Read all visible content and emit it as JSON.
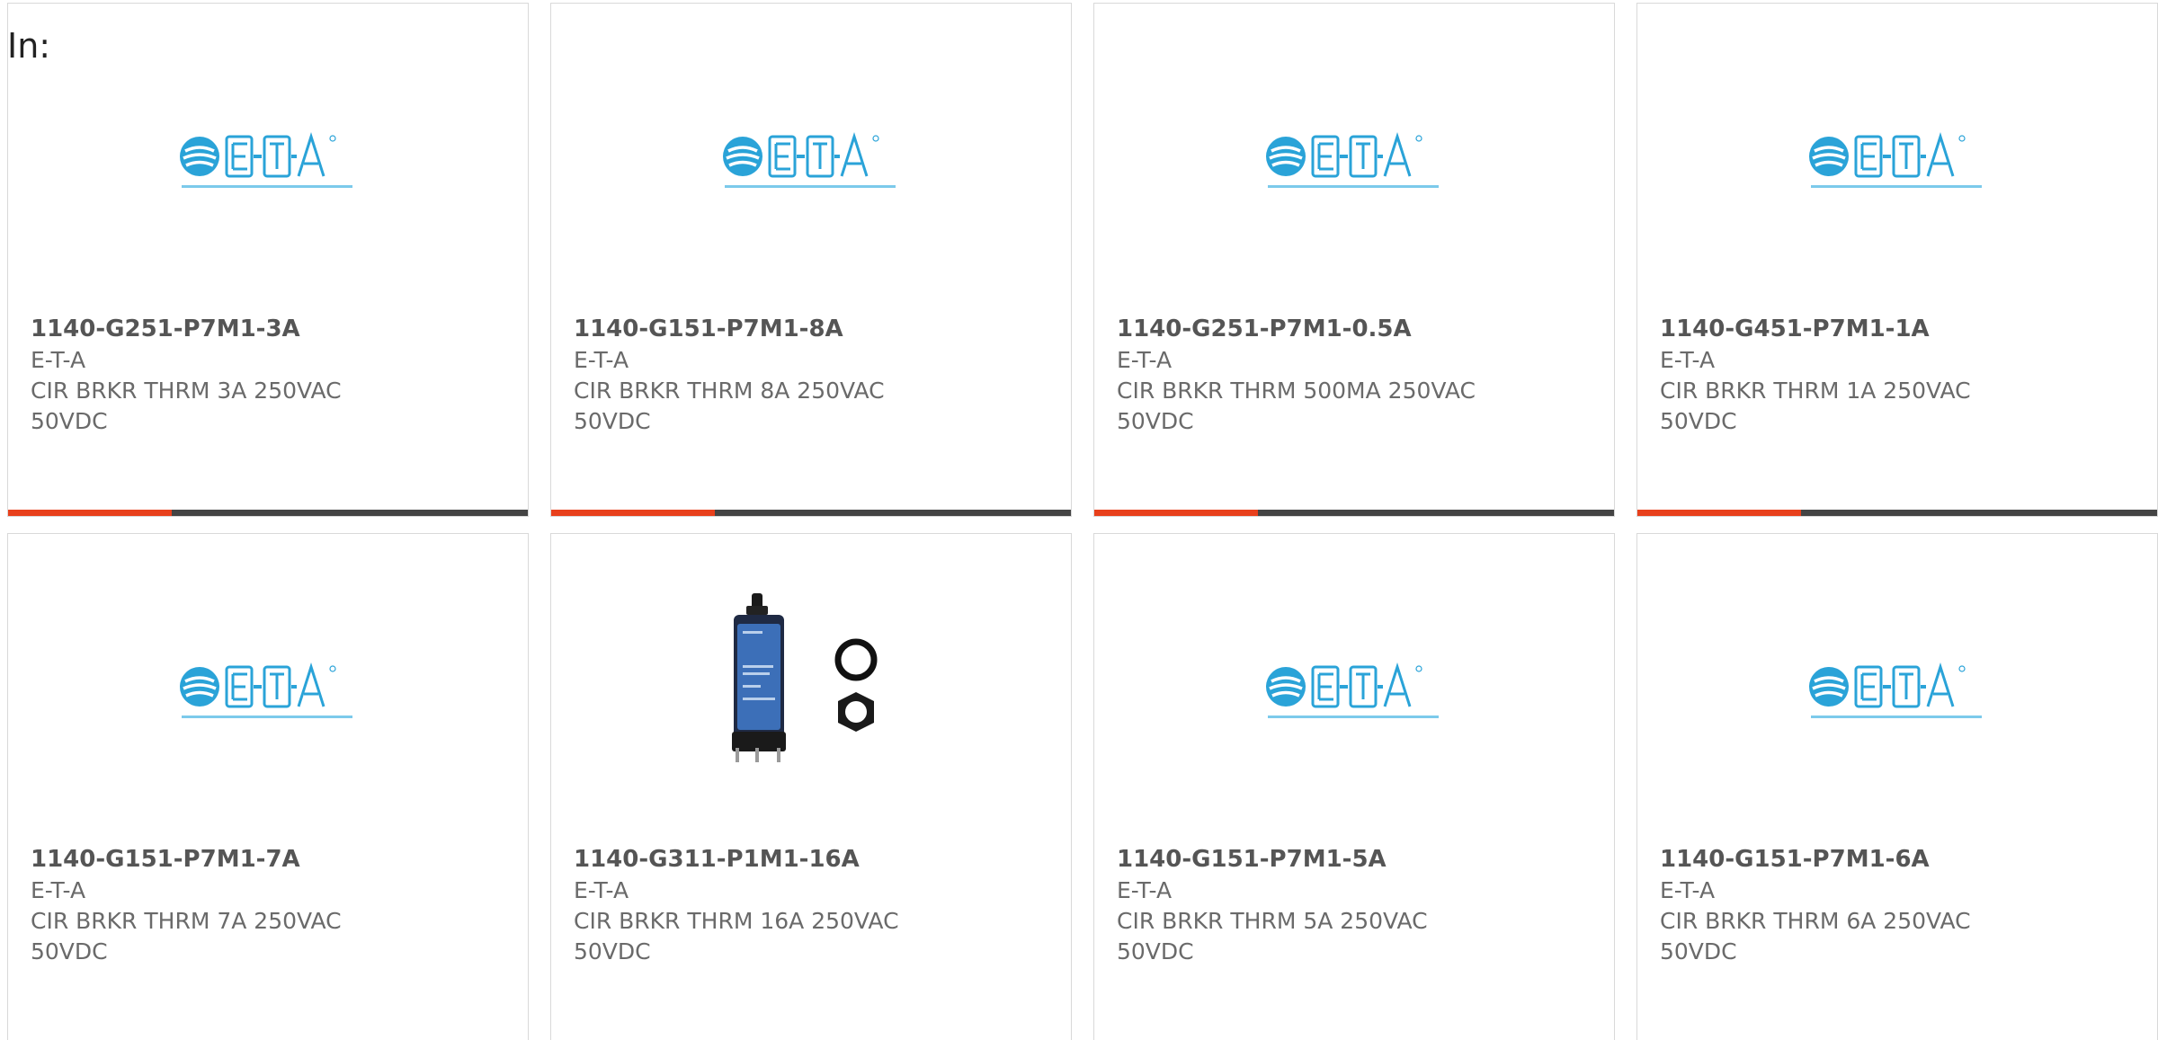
{
  "header": {
    "label": "In:"
  },
  "colors": {
    "accent": "#e8401c",
    "bar_dark": "#444444",
    "logo_blue": "#2aa3d8",
    "logo_light": "#7ccaeb"
  },
  "products": [
    {
      "part_number": "1140-G251-P7M1-3A",
      "manufacturer": "E-T-A",
      "description": "CIR BRKR THRM 3A 250VAC 50VDC",
      "image": "eta-logo-icon"
    },
    {
      "part_number": "1140-G151-P7M1-8A",
      "manufacturer": "E-T-A",
      "description": "CIR BRKR THRM 8A 250VAC 50VDC",
      "image": "eta-logo-icon"
    },
    {
      "part_number": "1140-G251-P7M1-0.5A",
      "manufacturer": "E-T-A",
      "description": "CIR BRKR THRM 500MA 250VAC 50VDC",
      "image": "eta-logo-icon"
    },
    {
      "part_number": "1140-G451-P7M1-1A",
      "manufacturer": "E-T-A",
      "description": "CIR BRKR THRM 1A 250VAC 50VDC",
      "image": "eta-logo-icon"
    },
    {
      "part_number": "1140-G151-P7M1-7A",
      "manufacturer": "E-T-A",
      "description": "CIR BRKR THRM 7A 250VAC 50VDC",
      "image": "eta-logo-icon"
    },
    {
      "part_number": "1140-G311-P1M1-16A",
      "manufacturer": "E-T-A",
      "description": "CIR BRKR THRM 16A 250VAC 50VDC",
      "image": "circuit-breaker-photo-icon"
    },
    {
      "part_number": "1140-G151-P7M1-5A",
      "manufacturer": "E-T-A",
      "description": "CIR BRKR THRM 5A 250VAC 50VDC",
      "image": "eta-logo-icon"
    },
    {
      "part_number": "1140-G151-P7M1-6A",
      "manufacturer": "E-T-A",
      "description": "CIR BRKR THRM 6A 250VAC 50VDC",
      "image": "eta-logo-icon"
    }
  ]
}
